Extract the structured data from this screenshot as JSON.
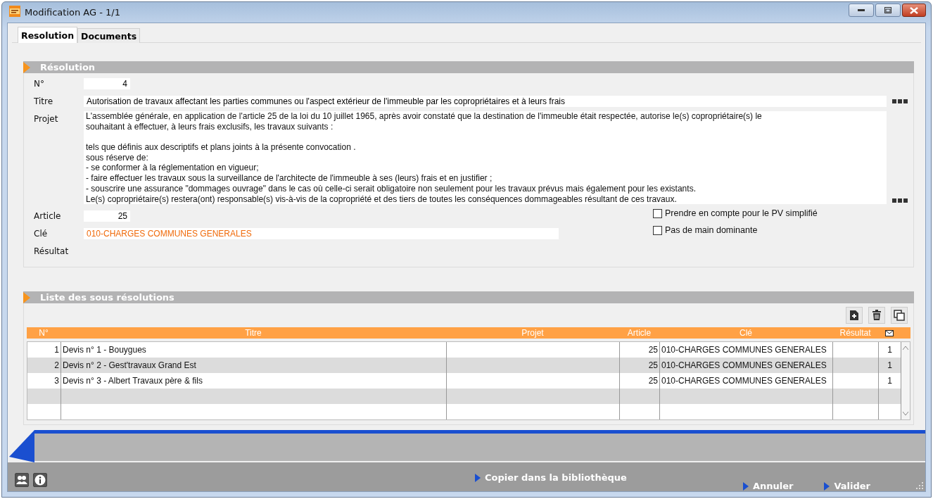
{
  "window": {
    "title": "Modification AG - 1/1"
  },
  "tabs": [
    {
      "label": "Resolution",
      "selected": true
    },
    {
      "label": "Documents",
      "selected": false
    }
  ],
  "resolution": {
    "title": "Résolution",
    "numero": {
      "label": "N°",
      "value": "4"
    },
    "titre": {
      "label": "Titre",
      "value": "Autorisation de travaux affectant les parties communes ou l'aspect extérieur de l'immeuble par les copropriétaires et à leurs frais"
    },
    "projet": {
      "label": "Projet",
      "paragraphs": [
        [
          "L'assemblée générale, en application de l'article 25 de la loi du 10 juillet 1965, après avoir constaté que la destination de l'immeuble était respectée, autorise le(s) copropriétaire(s) le",
          "souhaitant à effectuer, à leurs frais exclusifs, les travaux suivants :"
        ],
        [
          "tels que définis aux descriptifs et plans joints à la présente convocation .",
          "sous réserve de:",
          "- se conformer à la réglementation en vigueur;",
          "- faire effectuer les travaux sous la surveillance de l'architecte de l'immeuble à ses (leurs) frais et en justifier ;",
          "- souscrire une assurance \"dommages ouvrage\" dans le cas où celle-ci serait obligatoire non seulement pour les travaux prévus mais également pour les existants.",
          "Le(s) copropriétaire(s) restera(ont) responsable(s) vis-à-vis de la copropriété et des tiers de toutes les conséquences dommageables résultant de ces travaux."
        ]
      ]
    },
    "article": {
      "label": "Article",
      "value": "25"
    },
    "cle": {
      "label": "Clé",
      "value": "010-CHARGES COMMUNES GENERALES"
    },
    "resultat": {
      "label": "Résultat"
    },
    "options": [
      {
        "label": "Prendre en compte pour le PV simplifié",
        "checked": false
      },
      {
        "label": "Pas de main dominante",
        "checked": false
      }
    ]
  },
  "sub_resolutions": {
    "title": "Liste des sous résolutions",
    "columns": [
      "N°",
      "Titre",
      "Projet",
      "Article",
      "Clé",
      "Résultat"
    ],
    "rows": [
      {
        "n": "1",
        "titre": "Devis n° 1 - Bouygues",
        "article": "25",
        "cle": "010-CHARGES COMMUNES GENERALES",
        "count": "1"
      },
      {
        "n": "2",
        "titre": "Devis n° 2 - Gest'travaux Grand Est",
        "article": "25",
        "cle": "010-CHARGES COMMUNES GENERALES",
        "count": "1"
      },
      {
        "n": "3",
        "titre": "Devis n° 3 - Albert Travaux père & fils",
        "article": "25",
        "cle": "010-CHARGES COMMUNES GENERALES",
        "count": "1"
      }
    ]
  },
  "footer": {
    "copy": "Copier dans la bibliothèque",
    "cancel": "Annuler",
    "validate": "Valider"
  }
}
